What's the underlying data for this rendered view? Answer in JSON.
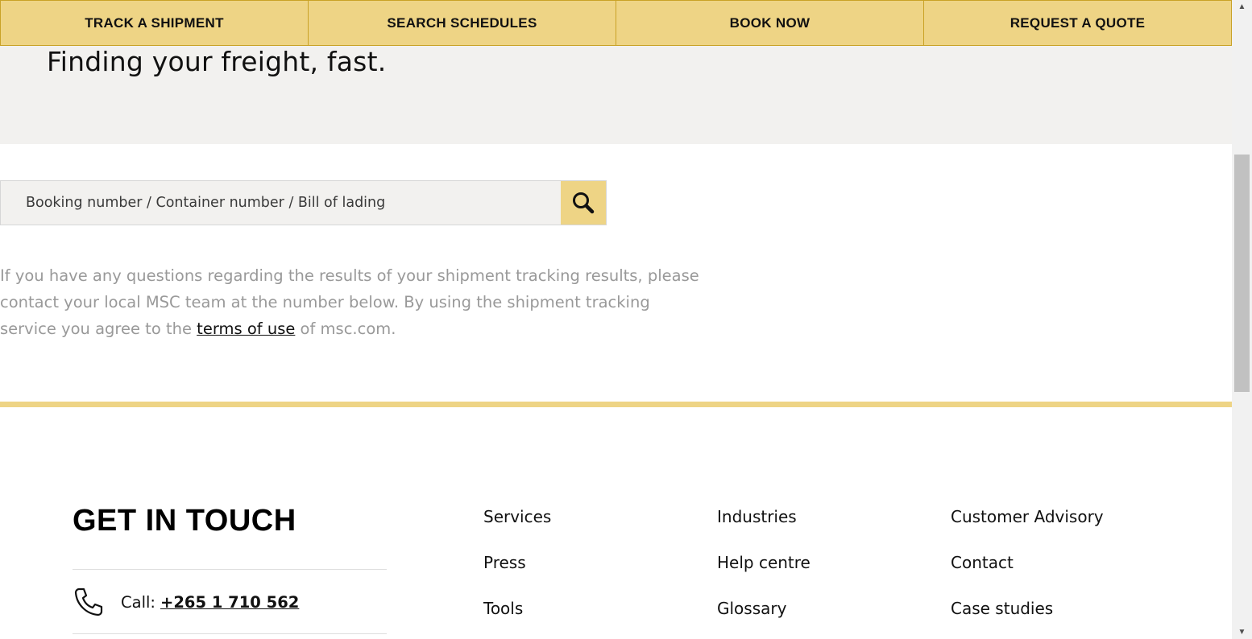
{
  "nav": {
    "items": [
      {
        "label": "TRACK A SHIPMENT"
      },
      {
        "label": "SEARCH SCHEDULES"
      },
      {
        "label": "BOOK NOW"
      },
      {
        "label": "REQUEST A QUOTE"
      }
    ]
  },
  "hero": {
    "title": "Finding your freight, fast."
  },
  "search": {
    "placeholder": "Booking number / Container number / Bill of lading",
    "button_icon": "search-icon"
  },
  "info": {
    "text_before": "If you have any questions regarding the results of your shipment tracking results, please contact your local MSC team at the number below. By using the shipment tracking service you agree to the ",
    "link_label": "terms of use",
    "text_after": " of msc.com."
  },
  "footer": {
    "heading": "GET IN TOUCH",
    "call_label": "Call:",
    "phone": "+265 1 710 562",
    "phone_icon": "phone-icon",
    "links": [
      {
        "label": "Services"
      },
      {
        "label": "Industries"
      },
      {
        "label": "Customer Advisory"
      },
      {
        "label": "Press"
      },
      {
        "label": "Help centre"
      },
      {
        "label": "Contact"
      },
      {
        "label": "Tools"
      },
      {
        "label": "Glossary"
      },
      {
        "label": "Case studies"
      }
    ]
  },
  "colors": {
    "accent_gold": "#eed485",
    "hero_bg": "#f2f1ef",
    "muted_text": "#999999"
  }
}
